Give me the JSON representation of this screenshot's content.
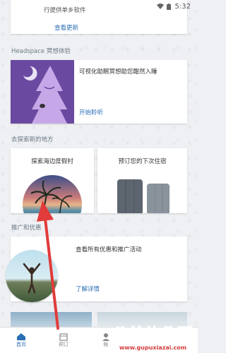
{
  "status": {
    "time": "5:32"
  },
  "top_card": {
    "text_partial": "行提供单乡软件",
    "link": "查看更新"
  },
  "headspace": {
    "section_title": "Headspace 冥想体验",
    "description": "可视化助眠冥想助您酣然入睡",
    "link": "开始聆听"
  },
  "explore": {
    "section_title": "去探索新的地方",
    "card1_label": "探索海边度假村",
    "card2_label": "预订您的下次住宿"
  },
  "promo": {
    "section_title": "推广和优惠",
    "description": "查看所有优惠和推广活动",
    "link": "了解详情"
  },
  "bottom_nav": {
    "item1": "首页",
    "item2": "预订",
    "item3": "帐"
  },
  "watermark": {
    "brand": "谷普软件园",
    "url": "www.gupuxiazai.com"
  },
  "colors": {
    "accent": "#2a6fb5",
    "headspace_purple": "#6a4aa0",
    "arrow": "#e23b3b"
  }
}
